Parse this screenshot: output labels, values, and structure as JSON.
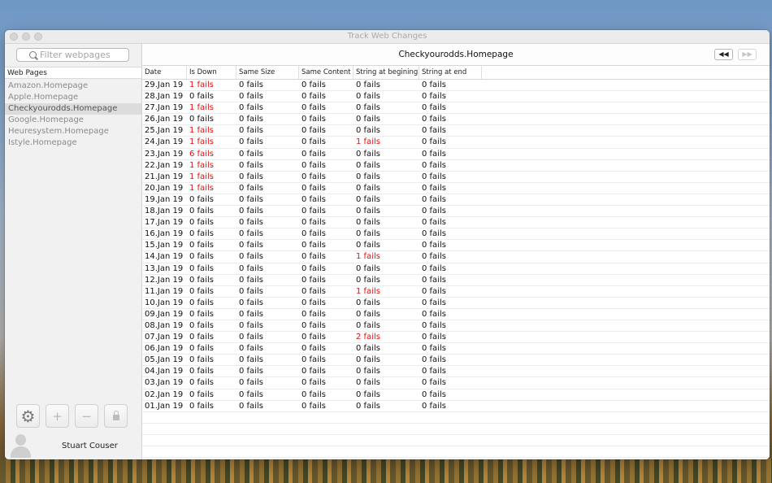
{
  "window": {
    "title": "Track Web Changes"
  },
  "sidebar": {
    "filter_placeholder": "Filter webpages",
    "header": "Web Pages",
    "items": [
      {
        "label": "Amazon.Homepage",
        "selected": false
      },
      {
        "label": "Apple.Homepage",
        "selected": false
      },
      {
        "label": "Checkyourodds.Homepage",
        "selected": true
      },
      {
        "label": "Google.Homepage",
        "selected": false
      },
      {
        "label": "Heuresystem.Homepage",
        "selected": false
      },
      {
        "label": "Istyle.Homepage",
        "selected": false
      }
    ],
    "buttons": {
      "settings": "gear-icon",
      "add": "+",
      "remove": "−",
      "lock": "lock-icon"
    },
    "user_name": "Stuart Couser"
  },
  "main": {
    "page_title": "Checkyourodds.Homepage",
    "nav_prev": "◀◀",
    "nav_next": "▶▶",
    "columns": [
      "Date",
      "Is Down",
      "Same Size",
      "Same Content",
      "String at begining",
      "String at end"
    ],
    "fail_color": "#e01010",
    "rows": [
      [
        "29.Jan 19",
        "1 fails",
        "0 fails",
        "0 fails",
        "0 fails",
        "0 fails"
      ],
      [
        "28.Jan 19",
        "0 fails",
        "0 fails",
        "0 fails",
        "0 fails",
        "0 fails"
      ],
      [
        "27.Jan 19",
        "1 fails",
        "0 fails",
        "0 fails",
        "0 fails",
        "0 fails"
      ],
      [
        "26.Jan 19",
        "0 fails",
        "0 fails",
        "0 fails",
        "0 fails",
        "0 fails"
      ],
      [
        "25.Jan 19",
        "1 fails",
        "0 fails",
        "0 fails",
        "0 fails",
        "0 fails"
      ],
      [
        "24.Jan 19",
        "1 fails",
        "0 fails",
        "0 fails",
        "1 fails",
        "0 fails"
      ],
      [
        "23.Jan 19",
        "6 fails",
        "0 fails",
        "0 fails",
        "0 fails",
        "0 fails"
      ],
      [
        "22.Jan 19",
        "1 fails",
        "0 fails",
        "0 fails",
        "0 fails",
        "0 fails"
      ],
      [
        "21.Jan 19",
        "1 fails",
        "0 fails",
        "0 fails",
        "0 fails",
        "0 fails"
      ],
      [
        "20.Jan 19",
        "1 fails",
        "0 fails",
        "0 fails",
        "0 fails",
        "0 fails"
      ],
      [
        "19.Jan 19",
        "0 fails",
        "0 fails",
        "0 fails",
        "0 fails",
        "0 fails"
      ],
      [
        "18.Jan 19",
        "0 fails",
        "0 fails",
        "0 fails",
        "0 fails",
        "0 fails"
      ],
      [
        "17.Jan 19",
        "0 fails",
        "0 fails",
        "0 fails",
        "0 fails",
        "0 fails"
      ],
      [
        "16.Jan 19",
        "0 fails",
        "0 fails",
        "0 fails",
        "0 fails",
        "0 fails"
      ],
      [
        "15.Jan 19",
        "0 fails",
        "0 fails",
        "0 fails",
        "0 fails",
        "0 fails"
      ],
      [
        "14.Jan 19",
        "0 fails",
        "0 fails",
        "0 fails",
        "1 fails",
        "0 fails"
      ],
      [
        "13.Jan 19",
        "0 fails",
        "0 fails",
        "0 fails",
        "0 fails",
        "0 fails"
      ],
      [
        "12.Jan 19",
        "0 fails",
        "0 fails",
        "0 fails",
        "0 fails",
        "0 fails"
      ],
      [
        "11.Jan 19",
        "0 fails",
        "0 fails",
        "0 fails",
        "1 fails",
        "0 fails"
      ],
      [
        "10.Jan 19",
        "0 fails",
        "0 fails",
        "0 fails",
        "0 fails",
        "0 fails"
      ],
      [
        "09.Jan 19",
        "0 fails",
        "0 fails",
        "0 fails",
        "0 fails",
        "0 fails"
      ],
      [
        "08.Jan 19",
        "0 fails",
        "0 fails",
        "0 fails",
        "0 fails",
        "0 fails"
      ],
      [
        "07.Jan 19",
        "0 fails",
        "0 fails",
        "0 fails",
        "2 fails",
        "0 fails"
      ],
      [
        "06.Jan 19",
        "0 fails",
        "0 fails",
        "0 fails",
        "0 fails",
        "0 fails"
      ],
      [
        "05.Jan 19",
        "0 fails",
        "0 fails",
        "0 fails",
        "0 fails",
        "0 fails"
      ],
      [
        "04.Jan 19",
        "0 fails",
        "0 fails",
        "0 fails",
        "0 fails",
        "0 fails"
      ],
      [
        "03.Jan 19",
        "0 fails",
        "0 fails",
        "0 fails",
        "0 fails",
        "0 fails"
      ],
      [
        "02.Jan 19",
        "0 fails",
        "0 fails",
        "0 fails",
        "0 fails",
        "0 fails"
      ],
      [
        "01.Jan 19",
        "0 fails",
        "0 fails",
        "0 fails",
        "0 fails",
        "0 fails"
      ]
    ]
  }
}
